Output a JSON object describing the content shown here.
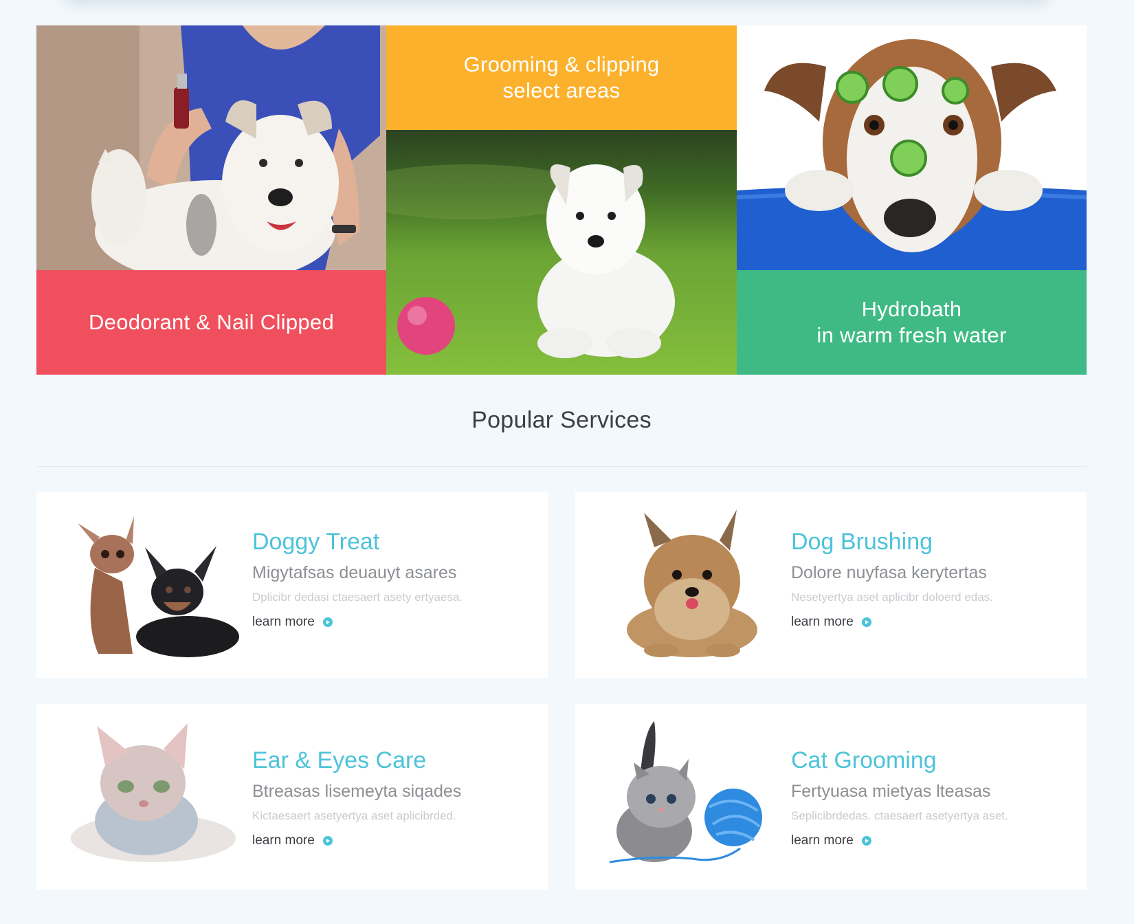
{
  "features": {
    "tiles": [
      {
        "caption": "Deodorant & Nail Clipped",
        "color": "#f0505d"
      },
      {
        "caption": "Grooming & clipping\nselect areas",
        "color": "#fbb12c"
      },
      {
        "caption": "Hydrobath\nin warm fresh water",
        "color": "#3fba85"
      }
    ],
    "photos": [
      "groomer-with-terrier-photo",
      "white-puppy-on-grass-photo",
      "dog-with-cucumber-mask-photo"
    ]
  },
  "popular": {
    "title": "Popular Services"
  },
  "services": [
    {
      "title": "Doggy Treat",
      "subtitle": "Migytafsas deuauyt asares",
      "description": "Dplicibr dedasi ctaesaert asety ertyaesa.",
      "link": "learn more",
      "image": "chihuahuas-photo"
    },
    {
      "title": "Dog Brushing",
      "subtitle": "Dolore nuyfasa kerytertas",
      "description": "Nesetyertya aset aplicibr doloerd edas.",
      "link": "learn more",
      "image": "yorkshire-terrier-photo"
    },
    {
      "title": "Ear & Eyes Care",
      "subtitle": "Btreasas lisemeyta siqades",
      "description": "Kictaesaert asetyertya aset aplicibrded.",
      "link": "learn more",
      "image": "sphynx-cat-photo"
    },
    {
      "title": "Cat Grooming",
      "subtitle": "Fertyuasa mietyas lteasas",
      "description": "Seplicibrdedas. ctaesaert asetyertya aset.",
      "link": "learn more",
      "image": "kitten-with-yarn-photo"
    }
  ],
  "theme": {
    "accent": "#4cc3d9",
    "background": "#f3f8fc"
  }
}
